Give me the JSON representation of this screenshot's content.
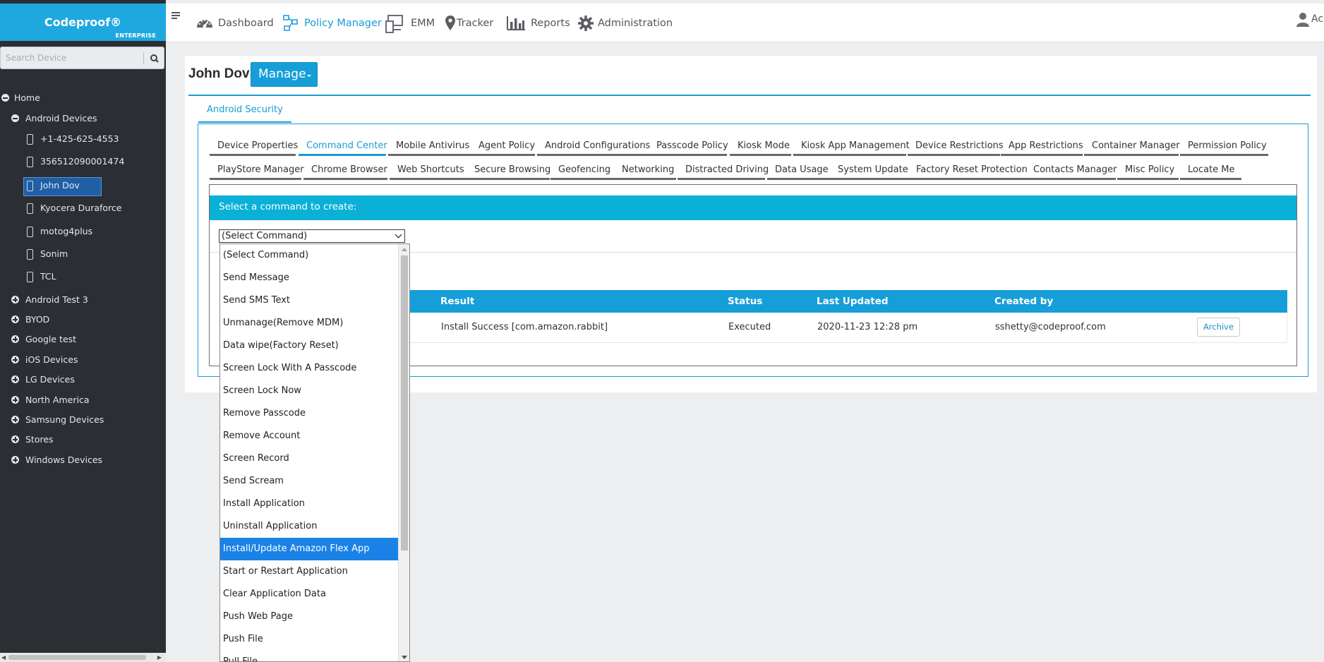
{
  "brand": {
    "name": "Codeproof®",
    "edition": "ENTERPRISE"
  },
  "search": {
    "placeholder": "Search Device",
    "icon": "search-icon"
  },
  "tree": {
    "root": "Home",
    "groups": [
      {
        "label": "Android Devices",
        "expanded": true
      },
      {
        "label": "Android Test 3",
        "expanded": false
      },
      {
        "label": "BYOD",
        "expanded": false
      },
      {
        "label": "Google test",
        "expanded": false
      },
      {
        "label": "iOS Devices",
        "expanded": false
      },
      {
        "label": "LG Devices",
        "expanded": false
      },
      {
        "label": "North America",
        "expanded": false
      },
      {
        "label": "Samsung Devices",
        "expanded": false
      },
      {
        "label": "Stores",
        "expanded": false
      },
      {
        "label": "Windows Devices",
        "expanded": false
      }
    ],
    "devices": [
      "+1-425-625-4553",
      "356512090001474",
      "John Dov",
      "Kyocera Duraforce",
      "motog4plus",
      "Sonim",
      "TCL"
    ],
    "selected_device": "John Dov"
  },
  "nav": {
    "items": [
      {
        "label": "Dashboard",
        "icon": "dashboard-icon"
      },
      {
        "label": "Policy Manager",
        "icon": "policy-manager-icon",
        "active": true
      },
      {
        "label": "EMM",
        "icon": "devices-icon"
      },
      {
        "label": "Tracker",
        "icon": "map-pin-icon"
      },
      {
        "label": "Reports",
        "icon": "bar-chart-icon"
      },
      {
        "label": "Administration",
        "icon": "gear-icon"
      }
    ],
    "user_partial": "Ac"
  },
  "page": {
    "title": "John Dov",
    "manage_label": "Manage",
    "section_tab": "Android Security"
  },
  "tabs_row1": [
    "Device Properties",
    "Command Center",
    "Mobile Antivirus",
    "Agent Policy",
    "Android Configurations",
    "Passcode Policy",
    "Kiosk Mode",
    "Kiosk App Management",
    "Device Restrictions",
    "App Restrictions",
    "Container Manager",
    "Permission Policy"
  ],
  "tabs_row2": [
    "PlayStore Manager",
    "Chrome Browser",
    "Web Shortcuts",
    "Secure Browsing",
    "Geofencing",
    "Networking",
    "Distracted Driving",
    "Data Usage",
    "System Update",
    "Factory Reset Protection",
    "Contacts Manager",
    "Misc Policy",
    "Locate Me"
  ],
  "active_tab": "Command Center",
  "command": {
    "bar_label": "Select a command to create:",
    "selected": "(Select Command)",
    "options": [
      "(Select Command)",
      "Send Message",
      "Send SMS Text",
      "Unmanage(Remove MDM)",
      "Data wipe(Factory Reset)",
      "Screen Lock With A Passcode",
      "Screen Lock Now",
      "Remove Passcode",
      "Remove Account",
      "Screen Record",
      "Send Scream",
      "Install Application",
      "Uninstall Application",
      "Install/Update Amazon Flex App",
      "Start or Restart Application",
      "Clear Application Data",
      "Push Web Page",
      "Push File",
      "Pull File"
    ],
    "highlighted": "Install/Update Amazon Flex App"
  },
  "table": {
    "headers": [
      "Result",
      "Status",
      "Last Updated",
      "Created by"
    ],
    "rows": [
      {
        "result": "Install Success [com.amazon.rabbit]",
        "status": "Executed",
        "last_updated": "2020-11-23 12:28 pm",
        "created_by": "sshetty@codeproof.com",
        "action": "Archive"
      }
    ]
  },
  "colors": {
    "brand": "#1fa8e0",
    "accent": "#1a9bd7",
    "sidebar": "#2b2e33",
    "command_bar": "#0ab0d5",
    "highlight": "#1a82e7"
  }
}
